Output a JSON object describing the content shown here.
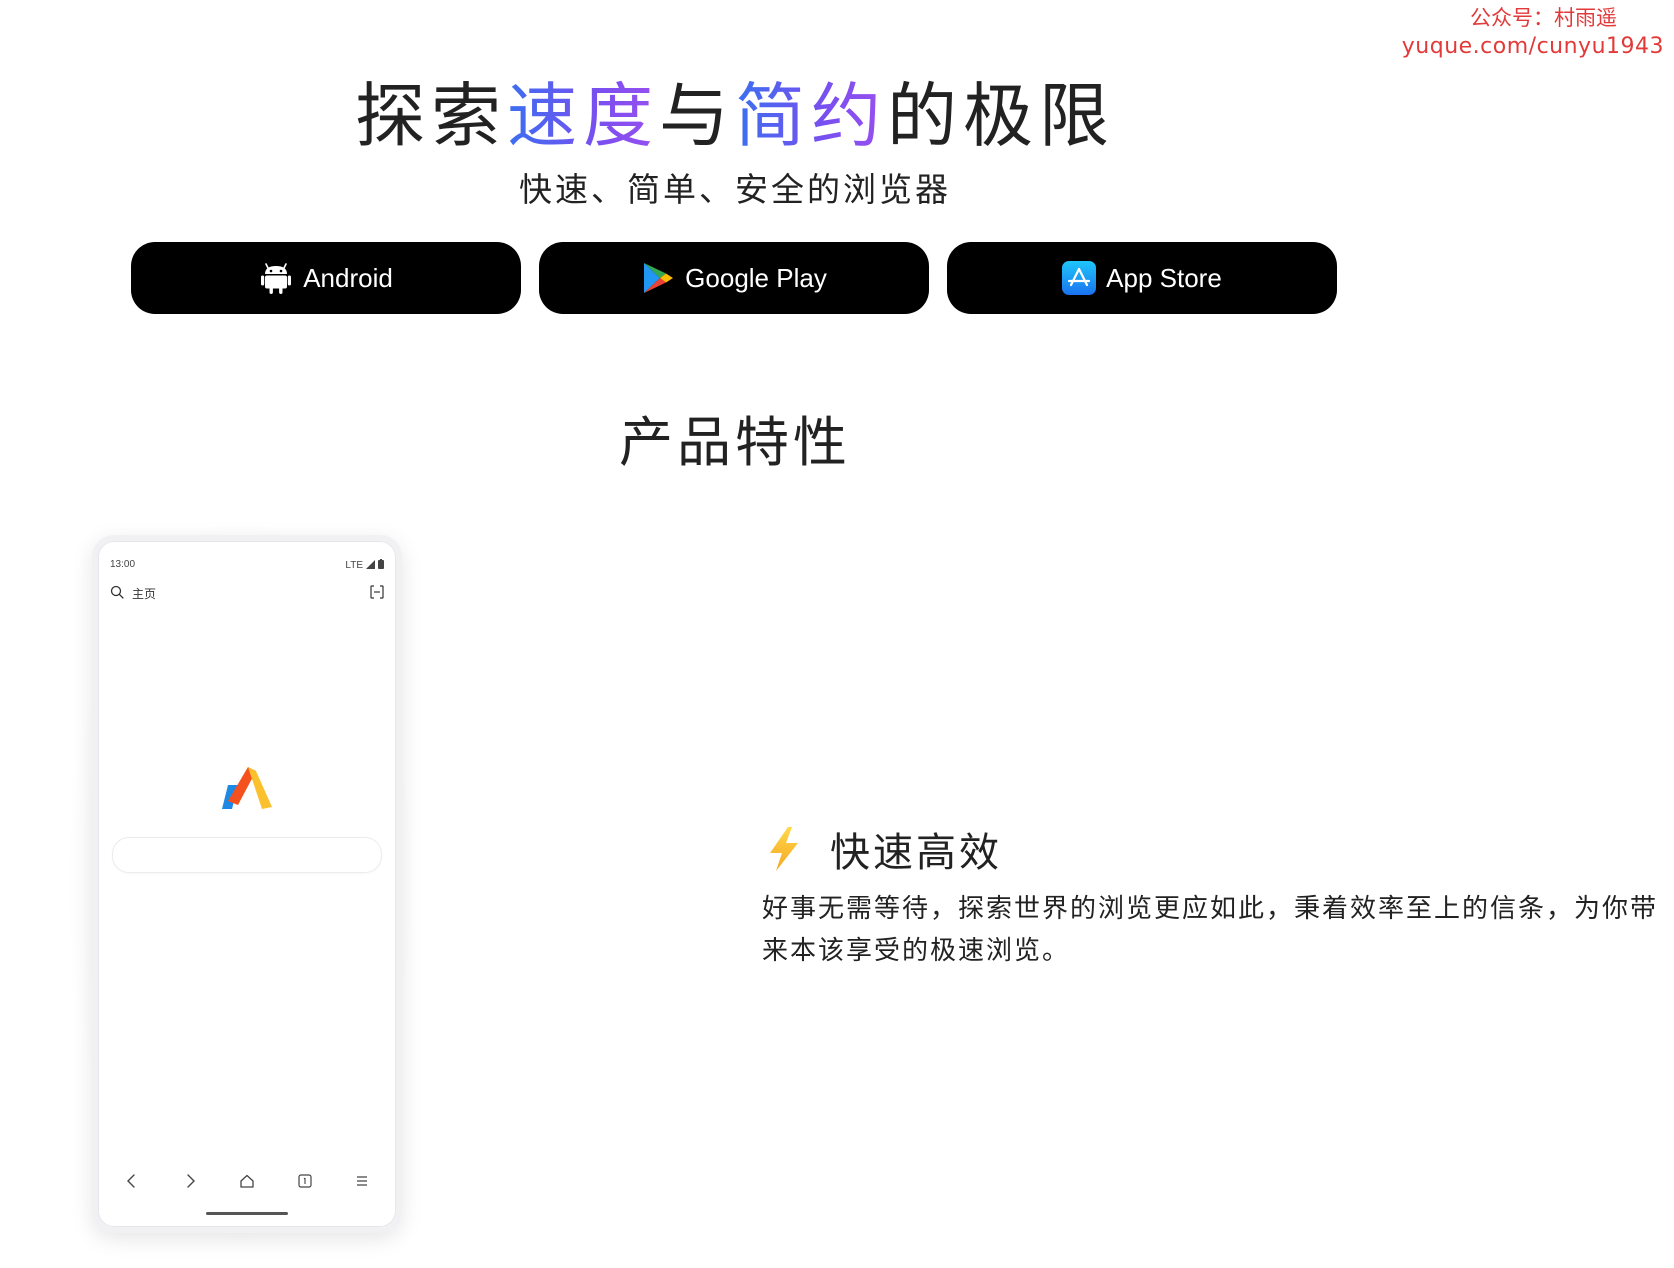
{
  "watermark": {
    "line1": "公众号：村雨遥",
    "line2": "yuque.com/cunyu1943"
  },
  "hero": {
    "title_part1": "探索",
    "title_grad1": "速度",
    "title_part2": "与",
    "title_grad2": "简约",
    "title_part3": "的极限",
    "subtitle": "快速、简单、安全的浏览器"
  },
  "downloads": [
    {
      "label": "Android",
      "icon": "android-icon"
    },
    {
      "label": "Google Play",
      "icon": "google-play-icon"
    },
    {
      "label": "App Store",
      "icon": "app-store-icon"
    }
  ],
  "features": {
    "heading": "产品特性",
    "items": [
      {
        "icon": "lightning-icon",
        "title": "快速高效",
        "desc": "好事无需等待，探索世界的浏览更应如此，秉着效率至上的信条，为你带来本该享受的极速浏览。"
      }
    ]
  },
  "phone": {
    "time": "13:00",
    "network": "LTE",
    "address_label": "主页"
  },
  "colors": {
    "button_bg": "#000000",
    "gradient_start": "#3a6ff0",
    "gradient_end": "#9a4ff0",
    "watermark": "#e23a3a"
  }
}
